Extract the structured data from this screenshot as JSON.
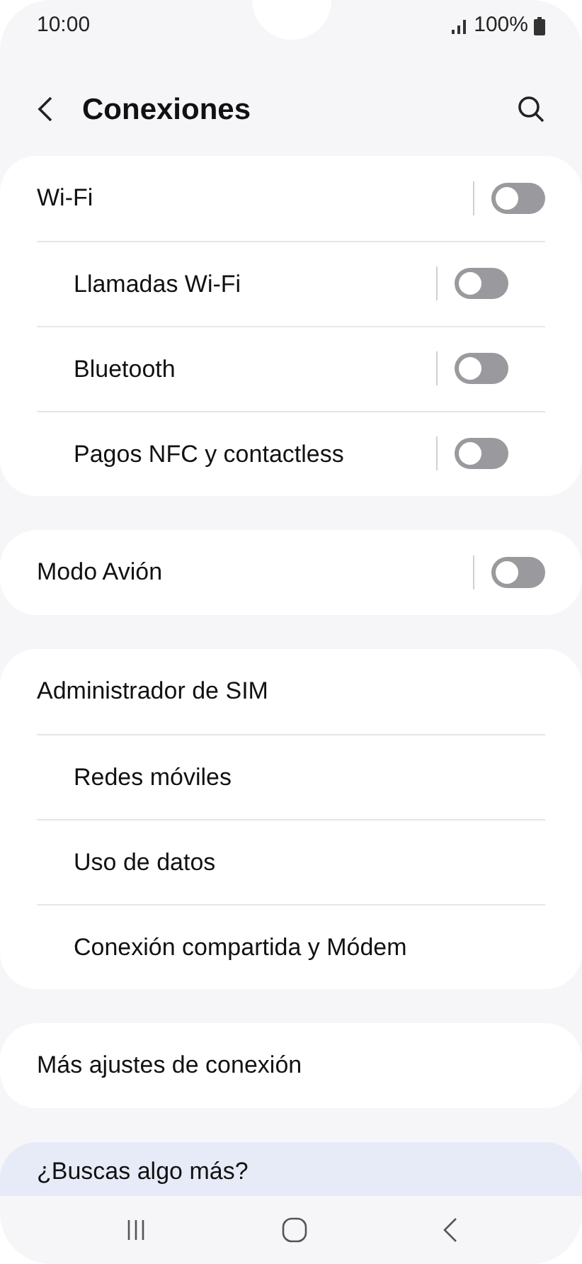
{
  "status_bar": {
    "time": "10:00",
    "battery": "100%"
  },
  "header": {
    "title": "Conexiones"
  },
  "groups": [
    {
      "items": [
        {
          "label": "Wi-Fi",
          "kind": "toggle",
          "on": false
        },
        {
          "label": "Llamadas Wi-Fi",
          "kind": "toggle",
          "on": false
        },
        {
          "label": "Bluetooth",
          "kind": "toggle",
          "on": false
        },
        {
          "label": "Pagos NFC y contactless",
          "kind": "toggle",
          "on": false
        }
      ]
    },
    {
      "items": [
        {
          "label": "Modo Avión",
          "kind": "toggle",
          "on": false
        }
      ]
    },
    {
      "items": [
        {
          "label": "Administrador de SIM",
          "kind": "link"
        },
        {
          "label": "Redes móviles",
          "kind": "link"
        },
        {
          "label": "Uso de datos",
          "kind": "link"
        },
        {
          "label": "Conexión compartida y Módem",
          "kind": "link"
        }
      ]
    },
    {
      "items": [
        {
          "label": "Más ajustes de conexión",
          "kind": "link"
        }
      ]
    }
  ],
  "suggestion": {
    "title": "¿Buscas algo más?"
  }
}
